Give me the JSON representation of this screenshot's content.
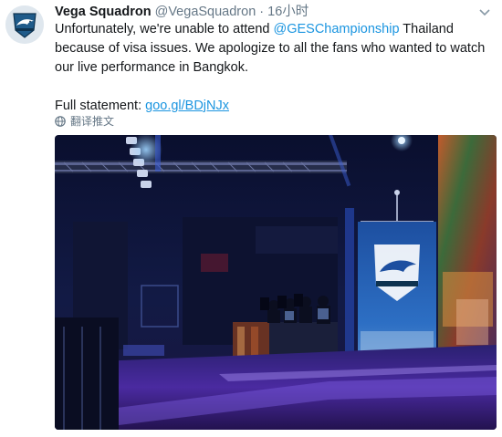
{
  "tweet": {
    "display_name": "Vega Squadron",
    "handle": "@VegaSquadron",
    "separator": "·",
    "time": "16小时",
    "text_part1": "Unfortunately, we're unable to attend ",
    "mention": "@GESChampionship",
    "text_part2": " Thailand because of visa issues. We apologize to all the fans who wanted to watch our live performance in Bangkok.",
    "statement_label": "Full statement: ",
    "statement_link": "goo.gl/BDjNJx",
    "translate_label": "翻译推文",
    "translate_icon": "globe-icon",
    "caret_icon": "chevron-down-icon"
  },
  "colors": {
    "link": "#1b95e0",
    "muted": "#657786",
    "text": "#14171a"
  }
}
